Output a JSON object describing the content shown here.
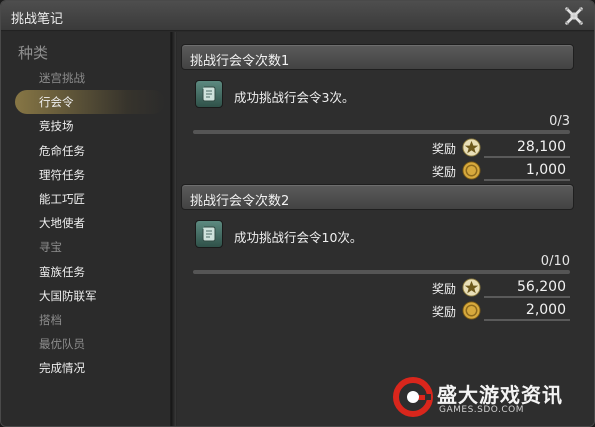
{
  "window": {
    "title": "挑战笔记"
  },
  "sidebar": {
    "header": "种类",
    "items": [
      {
        "label": "迷宫挑战",
        "state": "dim"
      },
      {
        "label": "行会令",
        "state": "active"
      },
      {
        "label": "竞技场",
        "state": "normal"
      },
      {
        "label": "危命任务",
        "state": "normal"
      },
      {
        "label": "理符任务",
        "state": "normal"
      },
      {
        "label": "能工巧匠",
        "state": "normal"
      },
      {
        "label": "大地使者",
        "state": "normal"
      },
      {
        "label": "寻宝",
        "state": "dim"
      },
      {
        "label": "蛮族任务",
        "state": "normal"
      },
      {
        "label": "大国防联军",
        "state": "normal"
      },
      {
        "label": "搭档",
        "state": "dim"
      },
      {
        "label": "最优队员",
        "state": "dim"
      },
      {
        "label": "完成情况",
        "state": "normal"
      }
    ]
  },
  "sections": [
    {
      "title": "挑战行会令次数1",
      "task": "成功挑战行会令3次。",
      "progress_text": "0/3",
      "progress_fraction": 0,
      "rewards": [
        {
          "label": "奖励",
          "icon": "seal-icon",
          "value": "28,100"
        },
        {
          "label": "奖励",
          "icon": "gil-coin-icon",
          "value": "1,000"
        }
      ]
    },
    {
      "title": "挑战行会令次数2",
      "task": "成功挑战行会令10次。",
      "progress_text": "0/10",
      "progress_fraction": 0,
      "rewards": [
        {
          "label": "奖励",
          "icon": "seal-icon",
          "value": "56,200"
        },
        {
          "label": "奖励",
          "icon": "gil-coin-icon",
          "value": "2,000"
        }
      ]
    }
  ],
  "watermark": {
    "name": "盛大游戏资讯",
    "url": "GAMES.SDO.COM"
  },
  "colors": {
    "accent_gold": "#c7a64f",
    "watermark_red": "#d9261c"
  }
}
